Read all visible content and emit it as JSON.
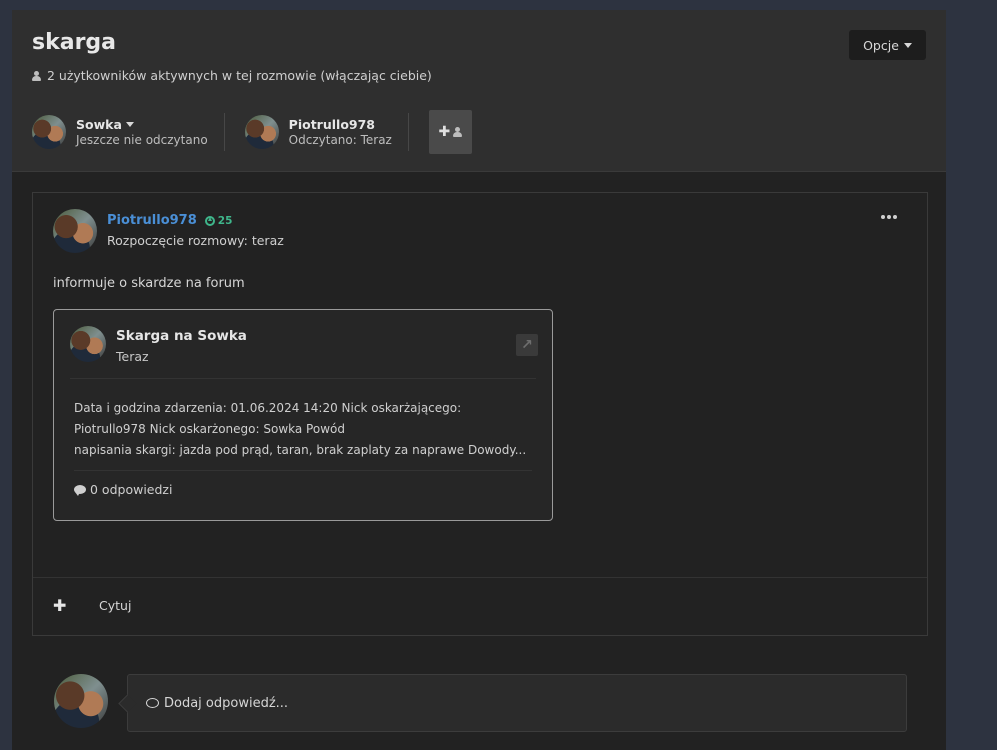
{
  "header": {
    "title": "skarga",
    "active_users": "2 użytkowników aktywnych w tej rozmowie (włączając ciebie)",
    "options_label": "Opcje"
  },
  "participants": [
    {
      "name": "Sowka",
      "status": "Jeszcze nie odczytano"
    },
    {
      "name": "Piotrullo978",
      "status": "Odczytano: Teraz"
    }
  ],
  "post": {
    "author": "Piotrullo978",
    "reputation": "25",
    "started": "Rozpoczęcie rozmowy: teraz",
    "text": "informuje o skardze na forum",
    "embed": {
      "title": "Skarga na Sowka",
      "time": "Teraz",
      "body_line1": "Data i godzina zdarzenia: 01.06.2024 14:20 Nick oskarżającego:",
      "body_line2": "Piotrullo978 Nick oskarżonego: Sowka Powód",
      "body_line3": "napisania skargi: jazda pod prąd, taran, brak zaplaty za naprawe Dowody...",
      "replies": "0 odpowiedzi"
    },
    "quote_label": "Cytuj"
  },
  "reply": {
    "placeholder": "Dodaj odpowiedź..."
  },
  "colors": {
    "author_link": "#4a8fd6",
    "reputation": "#3fb68b",
    "background": "#2d3340"
  }
}
